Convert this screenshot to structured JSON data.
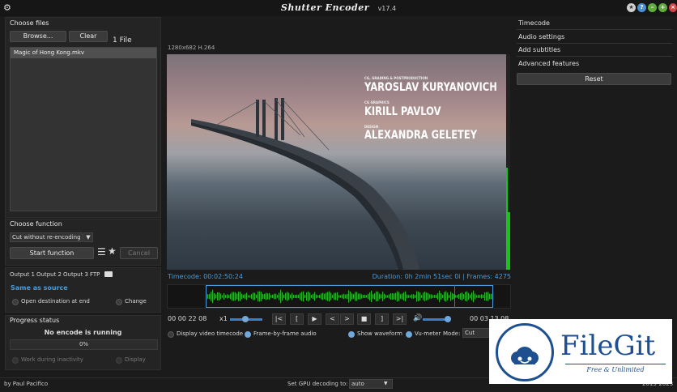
{
  "app": {
    "name": "Shutter Encoder",
    "version": "v17.4"
  },
  "choose_files": {
    "header": "Choose files",
    "browse": "Browse...",
    "clear": "Clear",
    "count": "1 File",
    "files": [
      "Magic of Hong Kong.mkv"
    ]
  },
  "choose_function": {
    "header": "Choose function",
    "selected": "Cut without re-encoding",
    "start": "Start function",
    "cancel": "Cancel"
  },
  "output": {
    "tabs": [
      "Output 1",
      "Output 2",
      "Output 3",
      "FTP"
    ],
    "destination": "Same as source",
    "open_destination": "Open destination at end",
    "change": "Change"
  },
  "progress": {
    "header": "Progress status",
    "status": "No encode is running",
    "percent": "0%",
    "work_inactivity": "Work during inactivity",
    "display": "Display"
  },
  "video": {
    "info": "1280x682 H.264",
    "credits": [
      {
        "role": "CG, GRADING & POSTPRODUCTION",
        "name": "YAROSLAV KURYANOVICH"
      },
      {
        "role": "CG GRAPHICS",
        "name": "KIRILL PAVLOV"
      },
      {
        "role": "DESIGN",
        "name": "ALEXANDRA GELETEY"
      }
    ],
    "timecode": "Timecode: 00:02:50:24",
    "duration": "Duration: 0h 2min 51sec 0i | Frames: 4275"
  },
  "player": {
    "time_in": "00 00 22 08",
    "speed": "x1",
    "time_out": "00 03 13 08",
    "buttons": [
      "|<",
      "[",
      "▶",
      "<",
      ">",
      "■",
      "]",
      ">|"
    ],
    "display_timecode": "Display video timecode",
    "frame_audio": "Frame-by-frame audio",
    "show_waveform": "Show waveform",
    "vu_meter": "Vu-meter",
    "mode_label": "Mode:",
    "mode_value": "Cut"
  },
  "right_panel": {
    "items": [
      "Timecode",
      "Audio settings",
      "Add subtitles",
      "Advanced features"
    ],
    "reset": "Reset"
  },
  "footer": {
    "author": "by Paul Pacifico",
    "gpu_label": "Set GPU decoding to:",
    "gpu_value": "auto",
    "years": "2013-2023"
  },
  "watermark": {
    "brand": "FileGit",
    "tagline": "Free & Unlimited"
  },
  "colors": {
    "accent": "#4a9bd8",
    "waveform": "#2fae2f",
    "vu": "#19c419",
    "playhead": "#e53935"
  }
}
